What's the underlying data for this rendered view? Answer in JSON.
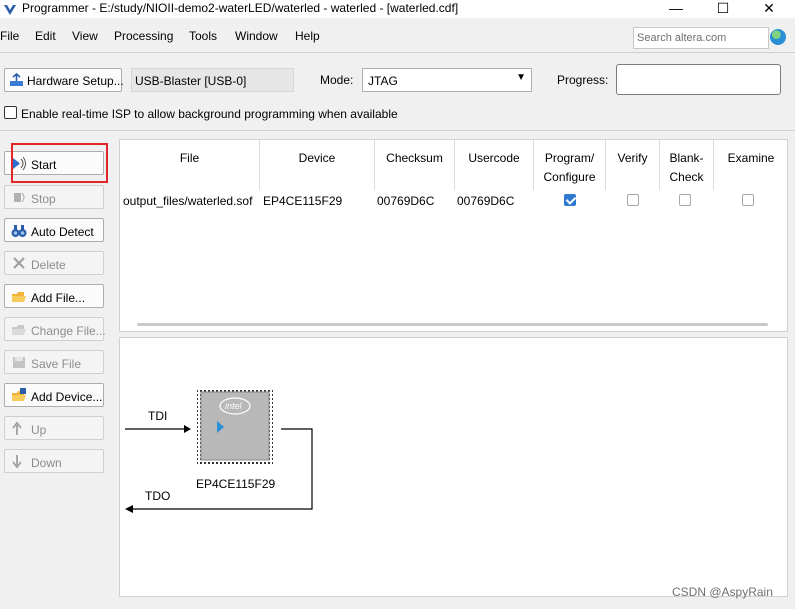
{
  "window": {
    "title": "Programmer - E:/study/NIOII-demo2-waterLED/waterled - waterled - [waterled.cdf]",
    "minimize_glyph": "—",
    "maximize_glyph": "☐",
    "close_glyph": "✕"
  },
  "menu": {
    "items": [
      "File",
      "Edit",
      "View",
      "Processing",
      "Tools",
      "Window",
      "Help"
    ],
    "search_placeholder": "Search altera.com"
  },
  "toolbar": {
    "hardware_setup_label": "Hardware Setup...",
    "hardware_value": "USB-Blaster [USB-0]",
    "mode_label": "Mode:",
    "mode_value": "JTAG",
    "progress_label": "Progress:",
    "isp_label": "Enable real-time ISP to allow background programming when available"
  },
  "sidebar": {
    "buttons": [
      {
        "label": "Start",
        "icon": "start-icon",
        "enabled": true
      },
      {
        "label": "Stop",
        "icon": "stop-icon",
        "enabled": false
      },
      {
        "label": "Auto Detect",
        "icon": "binoculars-icon",
        "enabled": true
      },
      {
        "label": "Delete",
        "icon": "delete-icon",
        "enabled": false
      },
      {
        "label": "Add File...",
        "icon": "add-file-icon",
        "enabled": true
      },
      {
        "label": "Change File...",
        "icon": "change-file-icon",
        "enabled": false
      },
      {
        "label": "Save File",
        "icon": "save-file-icon",
        "enabled": false
      },
      {
        "label": "Add Device...",
        "icon": "add-device-icon",
        "enabled": true
      },
      {
        "label": "Up",
        "icon": "up-icon",
        "enabled": false
      },
      {
        "label": "Down",
        "icon": "down-icon",
        "enabled": false
      }
    ]
  },
  "table": {
    "columns": [
      "File",
      "Device",
      "Checksum",
      "Usercode",
      "Program/\nConfigure",
      "Verify",
      "Blank-\nCheck",
      "Examine"
    ],
    "rows": [
      {
        "file": "output_files/waterled.sof",
        "device": "EP4CE115F29",
        "checksum": "00769D6C",
        "usercode": "00769D6C",
        "program": true,
        "verify": false,
        "blank_check": false,
        "examine": false
      }
    ]
  },
  "diagram": {
    "tdi_label": "TDI",
    "tdo_label": "TDO",
    "chip_brand": "intel",
    "chip_name": "EP4CE115F29"
  },
  "watermark": "CSDN @AspyRain",
  "colors": {
    "highlight": "#e0262b",
    "checkbox_on": "#2f79d0",
    "chip_body": "#b8b8b8",
    "chip_arrow": "#2b8fd6"
  }
}
